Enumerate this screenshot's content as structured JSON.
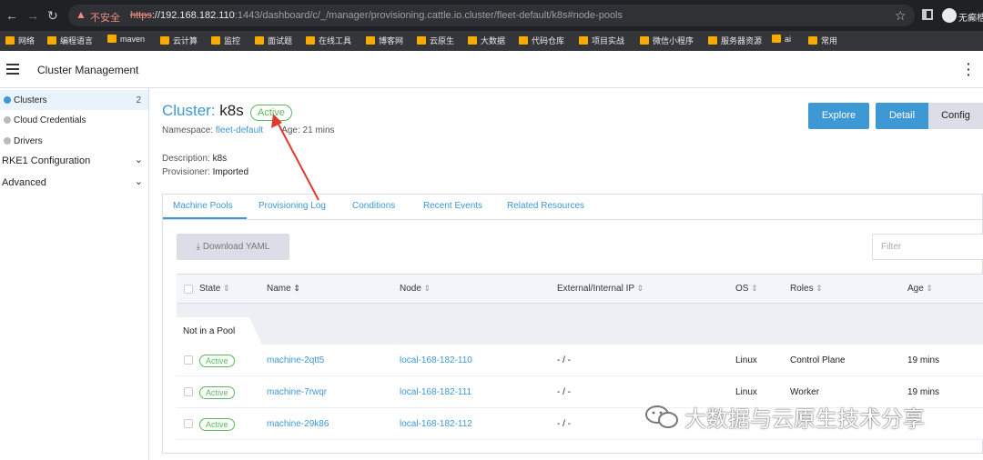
{
  "browser": {
    "insecure_label": "不安全",
    "url_scheme": "https",
    "url_host": "://192.168.182.110",
    "url_path": ":1443/dashboard/c/_/manager/provisioning.cattle.io.cluster/fleet-default/k8s#node-pools",
    "profile_label": "无癫梏",
    "bookmarks": [
      "网络",
      "编程语言",
      "maven",
      "云计算",
      "监控",
      "面试题",
      "在线工具",
      "博客网",
      "云原生",
      "大数据",
      "代码仓库",
      "项目实战",
      "微信小程序",
      "服务器资源",
      "ai",
      "常用"
    ]
  },
  "header": {
    "title": "Cluster Management"
  },
  "sidebar": {
    "items": [
      {
        "label": "Clusters",
        "count": "2"
      },
      {
        "label": "Cloud Credentials"
      },
      {
        "label": "Drivers"
      }
    ],
    "groups": [
      {
        "label": "RKE1 Configuration"
      },
      {
        "label": "Advanced"
      }
    ]
  },
  "cluster": {
    "prefix": "Cluster: ",
    "name": "k8s",
    "state": "Active",
    "namespace_label": "Namespace: ",
    "namespace": "fleet-default",
    "age_label": "Age: 21 mins",
    "description_label": "Description: ",
    "description": "k8s",
    "provisioner_label": "Provisioner: ",
    "provisioner": "Imported"
  },
  "actions": {
    "explore": "Explore",
    "detail": "Detail",
    "config": "Config"
  },
  "tabs": [
    "Machine Pools",
    "Provisioning Log",
    "Conditions",
    "Recent Events",
    "Related Resources"
  ],
  "toolbar": {
    "download_yaml": "Download YAML",
    "filter_placeholder": "Filter"
  },
  "table": {
    "columns": [
      "State",
      "Name",
      "Node",
      "External/Internal IP",
      "OS",
      "Roles",
      "Age"
    ],
    "group_label": "Not in a Pool",
    "rows": [
      {
        "state": "Active",
        "name": "machine-2qtt5",
        "node": "local-168-182-110",
        "ip": "- / -",
        "os": "Linux",
        "roles": "Control Plane",
        "age": "19 mins"
      },
      {
        "state": "Active",
        "name": "machine-7rwqr",
        "node": "local-168-182-111",
        "ip": "- / -",
        "os": "Linux",
        "roles": "Worker",
        "age": "19 mins"
      },
      {
        "state": "Active",
        "name": "machine-29k86",
        "node": "local-168-182-112",
        "ip": "- / -",
        "os": "",
        "roles": "",
        "age": ""
      }
    ]
  },
  "watermark": {
    "text": "大数据与云原生技术分享"
  },
  "colors": {
    "accent": "#3d98d3",
    "success": "#5cb85c",
    "annotation": "#e03b2e"
  }
}
